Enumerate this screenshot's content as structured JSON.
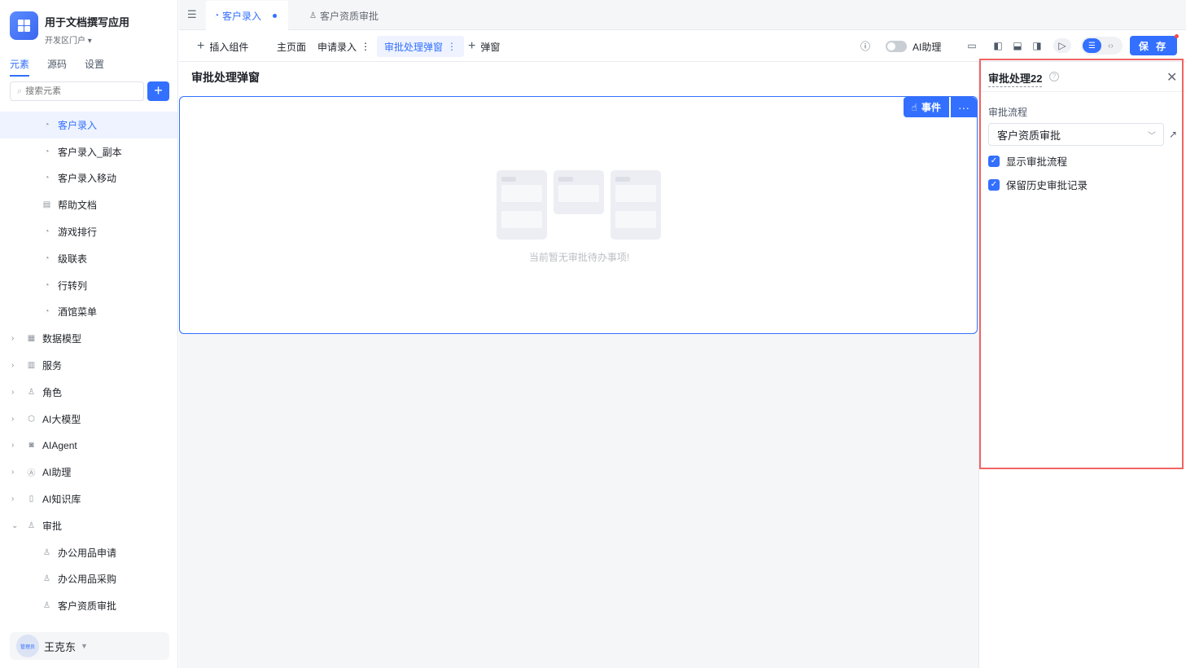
{
  "app": {
    "name": "用于文档撰写应用",
    "env": "开发区门户"
  },
  "sidebar": {
    "tabs": [
      "元素",
      "源码",
      "设置"
    ],
    "search_placeholder": "搜索元素",
    "items": [
      {
        "label": "客户录入",
        "icon": "page-icon",
        "kind": "child",
        "selected": true
      },
      {
        "label": "客户录入_副本",
        "icon": "page-icon",
        "kind": "child"
      },
      {
        "label": "客户录入移动",
        "icon": "page-icon",
        "kind": "child"
      },
      {
        "label": "帮助文档",
        "icon": "doc-icon",
        "kind": "child"
      },
      {
        "label": "游戏排行",
        "icon": "page-icon",
        "kind": "child"
      },
      {
        "label": "级联表",
        "icon": "page-icon",
        "kind": "child"
      },
      {
        "label": "行转列",
        "icon": "page-icon",
        "kind": "child"
      },
      {
        "label": "酒馆菜单",
        "icon": "page-icon",
        "kind": "child"
      },
      {
        "label": "数据模型",
        "icon": "table-icon",
        "kind": "parent"
      },
      {
        "label": "服务",
        "icon": "service-icon",
        "kind": "parent"
      },
      {
        "label": "角色",
        "icon": "role-icon",
        "kind": "parent"
      },
      {
        "label": "AI大模型",
        "icon": "model-icon",
        "kind": "parent"
      },
      {
        "label": "AIAgent",
        "icon": "robot-icon",
        "kind": "parent"
      },
      {
        "label": "AI助理",
        "icon": "ai-icon",
        "kind": "parent"
      },
      {
        "label": "AI知识库",
        "icon": "book-icon",
        "kind": "parent"
      },
      {
        "label": "审批",
        "icon": "stamp-icon",
        "kind": "parent",
        "expanded": true
      },
      {
        "label": "办公用品申请",
        "icon": "stamp-icon",
        "kind": "child"
      },
      {
        "label": "办公用品采购",
        "icon": "stamp-icon",
        "kind": "child"
      },
      {
        "label": "客户资质审批",
        "icon": "stamp-icon",
        "kind": "child"
      }
    ],
    "user": {
      "name": "王克东",
      "avatar_label": "管理员"
    }
  },
  "tabs": {
    "active": "客户录入",
    "inactive": "客户资质审批"
  },
  "toolbar": {
    "insert_label": "插入组件",
    "pages": [
      "主页面",
      "申请录入",
      "审批处理弹窗"
    ],
    "add_popup_label": "弹窗",
    "ai_assist_label": "AI助理",
    "save_label": "保 存"
  },
  "canvas": {
    "title": "审批处理弹窗",
    "event_label": "事件",
    "empty_text": "当前暂无审批待办事项!"
  },
  "panel": {
    "title": "审批处理22",
    "field_label": "审批流程",
    "select_value": "客户资质审批",
    "checks": [
      {
        "label": "显示审批流程",
        "checked": true
      },
      {
        "label": "保留历史审批记录",
        "checked": true
      }
    ]
  },
  "colors": {
    "accent": "#3370ff",
    "highlight": "#f06464"
  }
}
